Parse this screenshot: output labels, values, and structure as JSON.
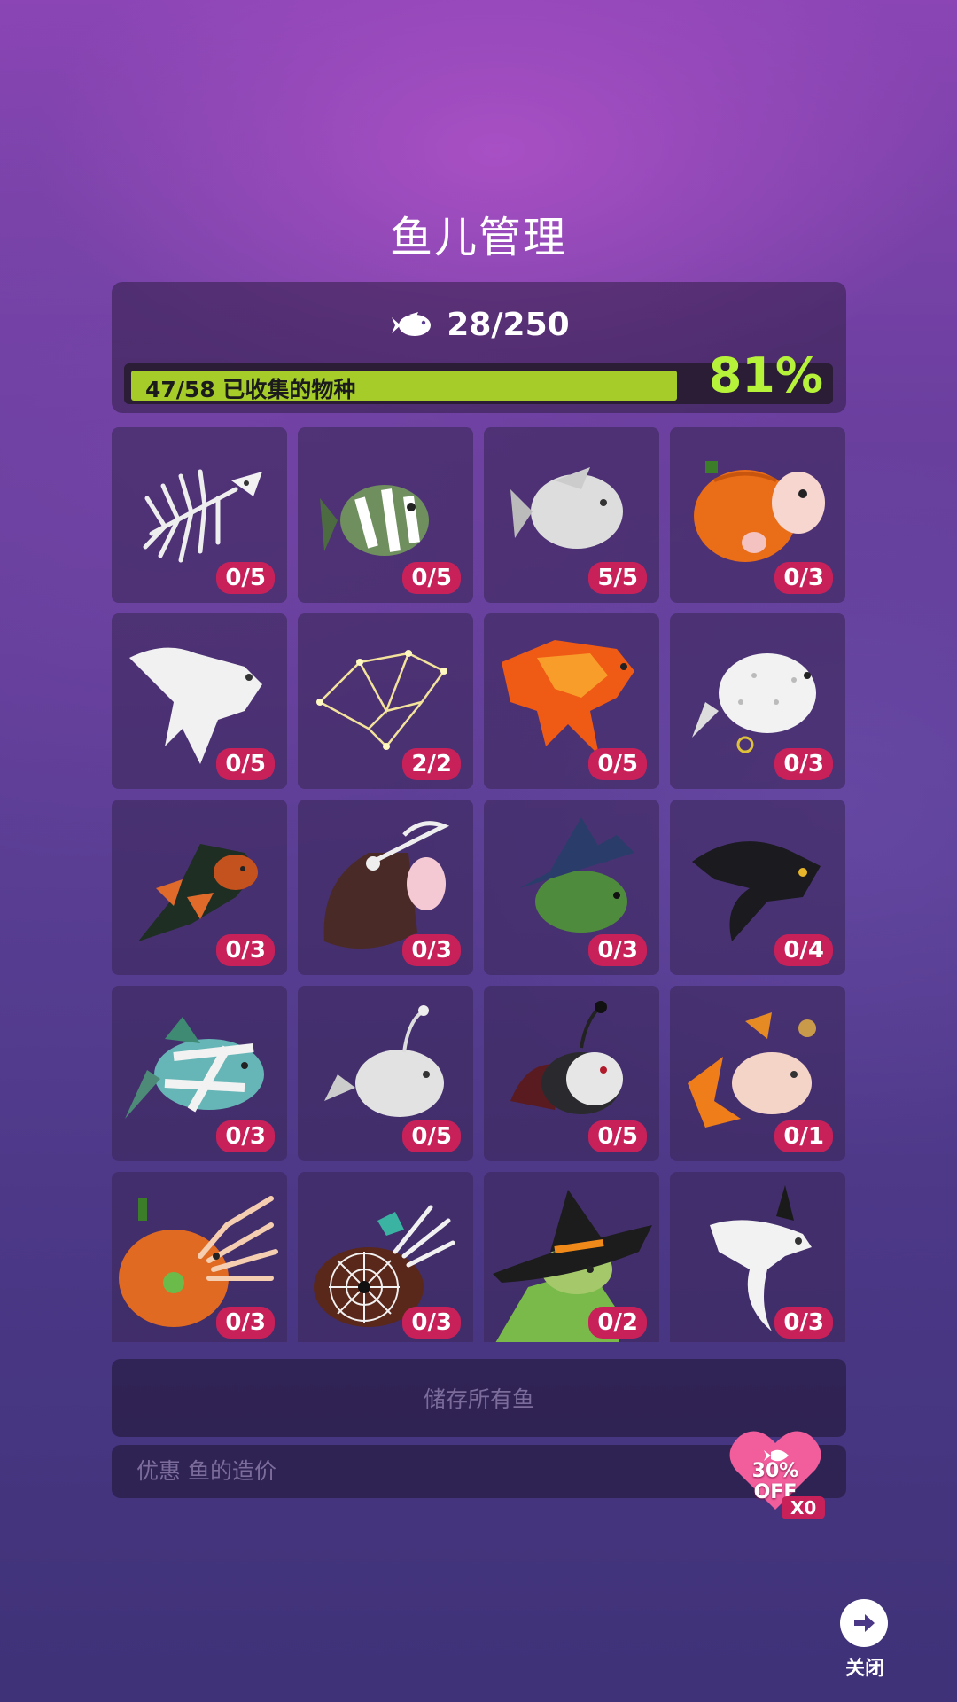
{
  "title": "鱼儿管理",
  "header": {
    "fish_icon": "fish-icon",
    "fish_count": "28/250",
    "collection_label": "47/58 已收集的物种",
    "collection_fraction": 0.81,
    "collection_pct": "81%"
  },
  "fish_cards": [
    {
      "name": "skeleton-fish",
      "count": "0/5"
    },
    {
      "name": "mummy-clownfish",
      "count": "0/5"
    },
    {
      "name": "ghost-angelfish",
      "count": "5/5"
    },
    {
      "name": "pumpkin-puffer",
      "count": "0/3"
    },
    {
      "name": "ghost-betta",
      "count": "0/5"
    },
    {
      "name": "constellation-fish",
      "count": "2/2"
    },
    {
      "name": "fire-betta",
      "count": "0/5"
    },
    {
      "name": "spotted-puffer",
      "count": "0/3"
    },
    {
      "name": "bat-fish",
      "count": "0/3"
    },
    {
      "name": "grim-reaper-fish",
      "count": "0/3"
    },
    {
      "name": "witch-fish",
      "count": "0/3"
    },
    {
      "name": "shadow-ray",
      "count": "0/4"
    },
    {
      "name": "mummy-fish",
      "count": "0/3"
    },
    {
      "name": "ghost-anglerfish",
      "count": "0/5"
    },
    {
      "name": "vampire-anglerfish",
      "count": "0/5"
    },
    {
      "name": "autumn-leaf-fish",
      "count": "0/1"
    },
    {
      "name": "pumpkin-squid",
      "count": "0/3"
    },
    {
      "name": "spider-web-squid",
      "count": "0/3"
    },
    {
      "name": "witch-frog",
      "count": "0/2"
    },
    {
      "name": "ghost-wisp-fish",
      "count": "0/3"
    }
  ],
  "store_all_button": "储存所有鱼",
  "discount": {
    "label": "优惠 鱼的造价",
    "percent": "30%",
    "off": "OFF",
    "multiplier": "X0"
  },
  "close": {
    "icon": "arrow-right-icon",
    "label": "关闭"
  }
}
